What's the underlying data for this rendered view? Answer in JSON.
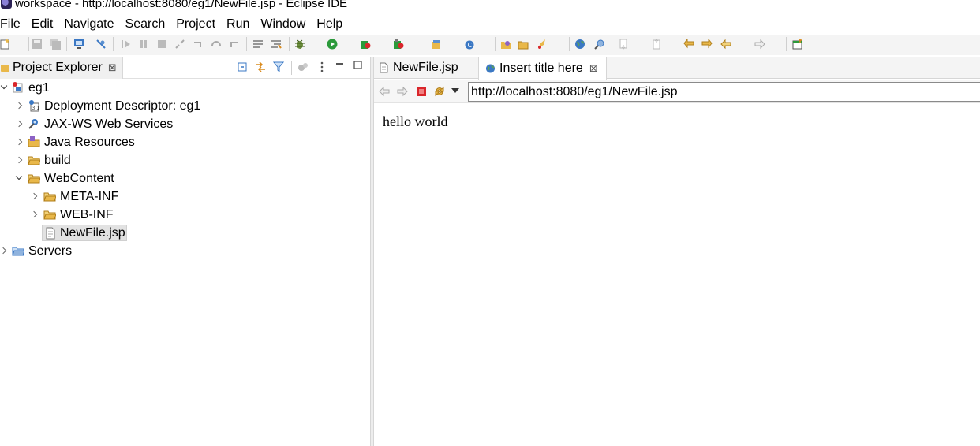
{
  "window": {
    "title": "workspace - http://localhost:8080/eg1/NewFile.jsp - Eclipse IDE"
  },
  "menubar": {
    "items": [
      "File",
      "Edit",
      "Navigate",
      "Search",
      "Project",
      "Run",
      "Window",
      "Help"
    ]
  },
  "project_explorer": {
    "tab_label": "Project Explorer",
    "tree": [
      {
        "label": "eg1",
        "icon": "web-project-icon"
      },
      {
        "label": "Deployment Descriptor: eg1",
        "icon": "deployment-descriptor-icon"
      },
      {
        "label": "JAX-WS Web Services",
        "icon": "web-services-icon"
      },
      {
        "label": "Java Resources",
        "icon": "java-resources-icon"
      },
      {
        "label": "build",
        "icon": "folder-icon"
      },
      {
        "label": "WebContent",
        "icon": "folder-icon"
      },
      {
        "label": "META-INF",
        "icon": "folder-icon"
      },
      {
        "label": "WEB-INF",
        "icon": "folder-icon"
      },
      {
        "label": "NewFile.jsp",
        "icon": "jsp-file-icon",
        "selected": true
      },
      {
        "label": "Servers",
        "icon": "folder-icon"
      }
    ]
  },
  "editor": {
    "tabs": [
      {
        "label": "NewFile.jsp",
        "icon": "jsp-file-icon",
        "active": false
      },
      {
        "label": "Insert title here",
        "icon": "globe-icon",
        "active": true
      }
    ],
    "browser": {
      "url": "http://localhost:8080/eg1/NewFile.jsp",
      "page_text": "hello world"
    }
  },
  "colors": {
    "folder": "#e9b84a",
    "stop_red": "#d9262b",
    "run_green": "#2c9a3b",
    "accent_blue": "#3b78c4"
  }
}
